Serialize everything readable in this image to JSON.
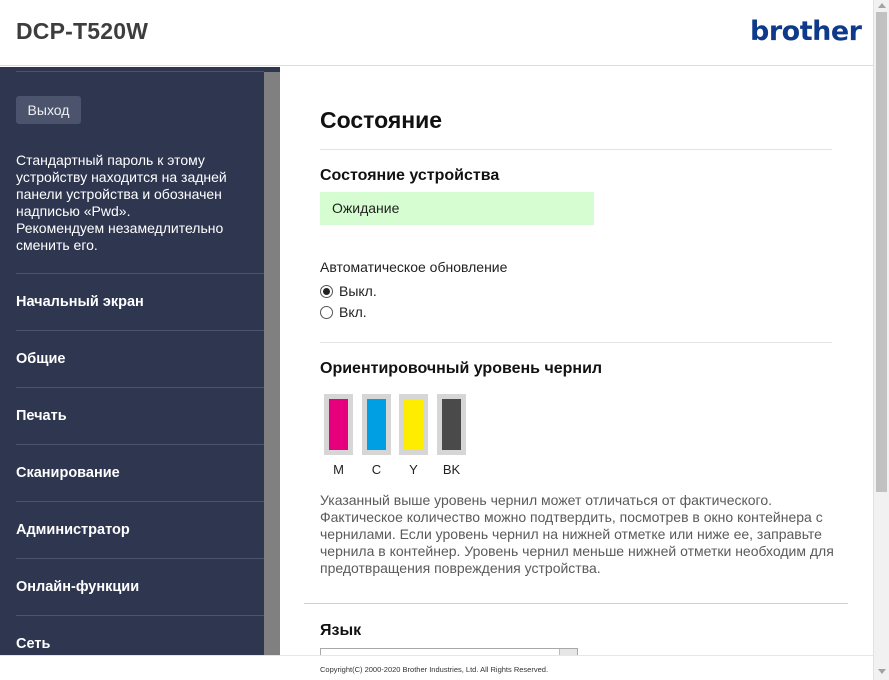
{
  "header": {
    "model": "DCP-T520W",
    "brand": "brother"
  },
  "sidebar": {
    "logout_label": "Выход",
    "notice": "Стандартный пароль к этому устройству находится на задней панели устройства и обозначен надписью «Pwd».\nРекомендуем незамедлительно сменить его.",
    "items": [
      {
        "label": "Начальный экран"
      },
      {
        "label": "Общие"
      },
      {
        "label": "Печать"
      },
      {
        "label": "Сканирование"
      },
      {
        "label": "Администратор"
      },
      {
        "label": "Онлайн-функции"
      },
      {
        "label": "Сеть"
      }
    ]
  },
  "main": {
    "title": "Состояние",
    "device_status": {
      "heading": "Состояние устройства",
      "value": "Ожидание",
      "color": "#d6fcd1"
    },
    "auto_refresh": {
      "label": "Автоматическое обновление",
      "options": [
        {
          "label": "Выкл.",
          "checked": true
        },
        {
          "label": "Вкл.",
          "checked": false
        }
      ]
    },
    "ink": {
      "heading": "Ориентировочный уровень чернил",
      "cartridges": [
        {
          "label": "M",
          "color": "#e6007e",
          "level": 1.0
        },
        {
          "label": "C",
          "color": "#009fe3",
          "level": 1.0
        },
        {
          "label": "Y",
          "color": "#ffed00",
          "level": 1.0
        },
        {
          "label": "BK",
          "color": "#4a4a4a",
          "level": 1.0
        }
      ],
      "note": "Указанный выше уровень чернил может отличаться от фактического. Фактическое количество можно подтвердить, посмотрев в окно контейнера с чернилами. Если уровень чернил на нижней отметке или ниже ее, заправьте чернила в контейнер. Уровень чернил меньше нижней отметки необходим для предотвращения повреждения устройства."
    },
    "language": {
      "heading": "Язык",
      "selected": ""
    }
  },
  "footer": {
    "copyright": "Copyright(C) 2000-2020 Brother Industries, Ltd. All Rights Reserved."
  }
}
